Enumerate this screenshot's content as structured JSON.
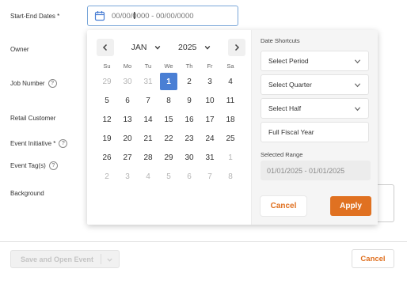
{
  "form": {
    "start_end_label": "Start-End Dates *",
    "owner_label": "Owner",
    "job_number_label": "Job Number",
    "retail_customer_label": "Retail Customer",
    "event_initiative_label": "Event Initiative *",
    "event_tags_label": "Event Tag(s)",
    "background_label": "Background",
    "help_glyph": "?",
    "date_placeholder": "00/00/0000 - 00/00/0000"
  },
  "footer": {
    "save_open_label": "Save and Open Event",
    "cancel_label": "Cancel"
  },
  "picker": {
    "month": "JAN",
    "year": "2025",
    "weekdays": [
      "Su",
      "Mo",
      "Tu",
      "We",
      "Th",
      "Fr",
      "Sa"
    ],
    "weeks": [
      [
        {
          "d": "29",
          "m": true
        },
        {
          "d": "30",
          "m": true
        },
        {
          "d": "31",
          "m": true
        },
        {
          "d": "1",
          "s": true
        },
        {
          "d": "2"
        },
        {
          "d": "3"
        },
        {
          "d": "4"
        }
      ],
      [
        {
          "d": "5"
        },
        {
          "d": "6"
        },
        {
          "d": "7"
        },
        {
          "d": "8"
        },
        {
          "d": "9"
        },
        {
          "d": "10"
        },
        {
          "d": "11"
        }
      ],
      [
        {
          "d": "12"
        },
        {
          "d": "13"
        },
        {
          "d": "14"
        },
        {
          "d": "15"
        },
        {
          "d": "16"
        },
        {
          "d": "17"
        },
        {
          "d": "18"
        }
      ],
      [
        {
          "d": "19"
        },
        {
          "d": "20"
        },
        {
          "d": "21"
        },
        {
          "d": "22"
        },
        {
          "d": "23"
        },
        {
          "d": "24"
        },
        {
          "d": "25"
        }
      ],
      [
        {
          "d": "26"
        },
        {
          "d": "27"
        },
        {
          "d": "28"
        },
        {
          "d": "29"
        },
        {
          "d": "30"
        },
        {
          "d": "31"
        },
        {
          "d": "1",
          "m": true
        }
      ],
      [
        {
          "d": "2",
          "m": true
        },
        {
          "d": "3",
          "m": true
        },
        {
          "d": "4",
          "m": true
        },
        {
          "d": "5",
          "m": true
        },
        {
          "d": "6",
          "m": true
        },
        {
          "d": "7",
          "m": true
        },
        {
          "d": "8",
          "m": true
        }
      ]
    ],
    "shortcuts_title": "Date Shortcuts",
    "select_period": "Select Period",
    "select_quarter": "Select Quarter",
    "select_half": "Select Half",
    "full_fiscal_year": "Full Fiscal Year",
    "selected_range_label": "Selected Range",
    "selected_range_value": "01/01/2025 - 01/01/2025",
    "cancel_label": "Cancel",
    "apply_label": "Apply"
  },
  "colors": {
    "accent_orange": "#e07121",
    "selected_blue": "#4a7fd4",
    "input_border": "#7aa7d9"
  }
}
